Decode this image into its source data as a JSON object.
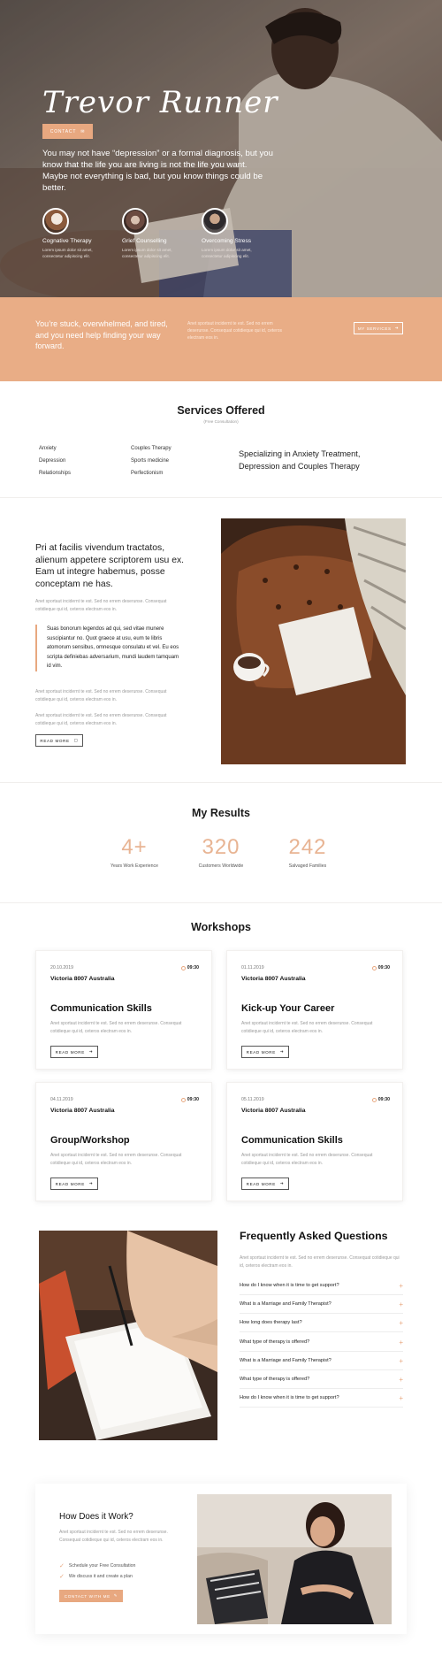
{
  "hero": {
    "title": "Trevor Runner",
    "contact_label": "CONTACT",
    "lead": "You may not have “depression” or a formal diagnosis, but you know that the life you are living is not the life you want. Maybe not everything is bad, but you know things could be better.",
    "services": [
      {
        "title": "Cognative Therapy",
        "text": "Lorem ipsum dolor sit amet, consectetur adipiscing elit."
      },
      {
        "title": "Grief Counselling",
        "text": "Lorem ipsum dolor sit amet, consectetur adipiscing elit."
      },
      {
        "title": "Overcoming Stress",
        "text": "Lorem ipsum dolor sit amet, consectetur adipiscing elit."
      }
    ]
  },
  "band": {
    "lead": "You’re stuck, overwhelmed, and tired, and you need help finding your way forward.",
    "text": "Anet sportaut incidernt te est. Sed no errem deserunse. Consequat cotidieque qui id, ceteros electram eos in.",
    "button_label": "MY SERVICES"
  },
  "services_offered": {
    "title": "Services Offered",
    "subtitle": "(Free Consultation)",
    "col1": [
      "Anxiety",
      "Depression",
      "Relationships"
    ],
    "col2": [
      "Couples Therapy",
      "Sports medicine",
      "Perfectionism"
    ],
    "specializing": "Specializing in Anxiety Treatment, Depression and Couples Therapy"
  },
  "about": {
    "heading": "Pri at facilis vivendum tractatos, alienum appetere scriptorem usu ex. Eam ut integre habemus, posse conceptam ne has.",
    "para1": "Anet sportaut incidernt te est. Sed no errem deserunse. Consequat cotidieque qui id, ceteros electram eos in.",
    "quote": "Suas bonorum legendos ad qui, sed vitae munere suscipiantur no. Quot graece at usu, eum te libris atomorum sensibus, omnesque consulatu et vel. Eu eos scripta definiebas adversarium, mundi laudem tamquam id vim.",
    "para2": "Anet sportaut incidernt te est. Sed no errem deserunse. Consequat cotidieque qui id, ceteros electram eos in.",
    "para3": "Anet sportaut incidernt te est. Sed no errem deserunse. Consequat cotidieque qui id, ceteros electram eos in.",
    "button_label": "READ MORE"
  },
  "results": {
    "title": "My Results",
    "stats": [
      {
        "value": "4+",
        "label": "Years Work Experience"
      },
      {
        "value": "320",
        "label": "Customers Worldwide"
      },
      {
        "value": "242",
        "label": "Salvaged Families"
      }
    ]
  },
  "workshops": {
    "title": "Workshops",
    "items": [
      {
        "date": "20.10.2019",
        "time": "09:30",
        "location": "Victoria 8007 Australia",
        "title": "Communication Skills",
        "text": "Anet sportaut incidernt te est. Sed no errem deserunse. Consequat cotidieque qui id, ceteros electram eos in.",
        "button": "READ MORE"
      },
      {
        "date": "01.11.2019",
        "time": "09:30",
        "location": "Victoria 8007 Australia",
        "title": "Kick-up Your Career",
        "text": "Anet sportaut incidernt te est. Sed no errem deserunse. Consequat cotidieque qui id, ceteros electram eos in.",
        "button": "READ MORE"
      },
      {
        "date": "04.11.2019",
        "time": "09:30",
        "location": "Victoria 8007 Australia",
        "title": "Group/Workshop",
        "text": "Anet sportaut incidernt te est. Sed no errem deserunse. Consequat cotidieque qui id, ceteros electram eos in.",
        "button": "READ MORE"
      },
      {
        "date": "05.11.2019",
        "time": "09:30",
        "location": "Victoria 8007 Australia",
        "title": "Communication Skills",
        "text": "Anet sportaut incidernt te est. Sed no errem deserunse. Consequat cotidieque qui id, ceteros electram eos in.",
        "button": "READ MORE"
      }
    ]
  },
  "faq": {
    "title": "Frequently Asked Questions",
    "text": "Anet sportaut incidernt te est. Sed no errem deserunse. Consequat cotidieque qui id, ceteros electram eos in.",
    "items": [
      "How do I know when it is time to get support?",
      "What is a Marriage and Family Therapist?",
      "How long does therapy last?",
      "What type of therapy is offered?",
      "What is a Marriage and Family Therapist?",
      "What type of therapy is offered?",
      "How do I know when it is time to get support?"
    ]
  },
  "how": {
    "title": "How Does it Work?",
    "text": "Anet sportaut incidernt te est. Sed no errem deserunse. Consequat cotidieque qui id, ceteros electram eos in.",
    "steps": [
      "Schedule your Free Consultation",
      "We discuss it and create a plan"
    ],
    "button_label": "CONTACT WITH ME"
  },
  "colors": {
    "accent": "#e8a880",
    "band": "#e9ad86",
    "stat": "#e8b493"
  },
  "icons": [
    "envelope-icon",
    "arrow-right-icon",
    "clock-icon",
    "plus-icon",
    "check-icon",
    "pencil-icon"
  ]
}
